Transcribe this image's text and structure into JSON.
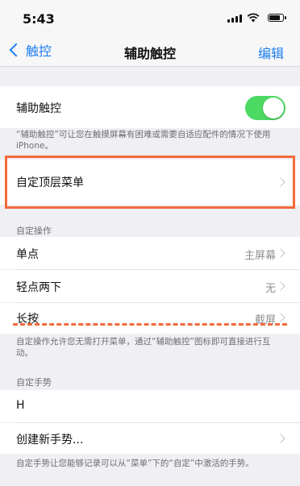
{
  "status_bar": {
    "time": "5:43"
  },
  "nav": {
    "back_label": "触控",
    "title": "辅助触控",
    "edit_label": "编辑"
  },
  "assistive_touch": {
    "label": "辅助触控",
    "enabled": true,
    "note": "“辅助触控”可让您在触摸屏幕有困难或需要自适应配件的情况下使用iPhone。"
  },
  "customize_menu": {
    "label": "自定顶层菜单"
  },
  "custom_actions": {
    "header": "自定操作",
    "items": [
      {
        "label": "单点",
        "value": "主屏幕"
      },
      {
        "label": "轻点两下",
        "value": "无"
      },
      {
        "label": "长按",
        "value": "截屏"
      }
    ],
    "note": "自定操作允许您无需打开菜单，通过“辅助触控”图标即可直接进行互动。"
  },
  "custom_gestures": {
    "header": "自定手势",
    "items": [
      {
        "label": "H"
      },
      {
        "label": "创建新手势..."
      }
    ],
    "note": "自定手势让您能够记录可以从“菜单”下的“自定”中激活的手势。"
  },
  "colors": {
    "accent": "#1e7ef0",
    "toggle_on": "#4cd964",
    "annotation": "#f26a3a"
  }
}
